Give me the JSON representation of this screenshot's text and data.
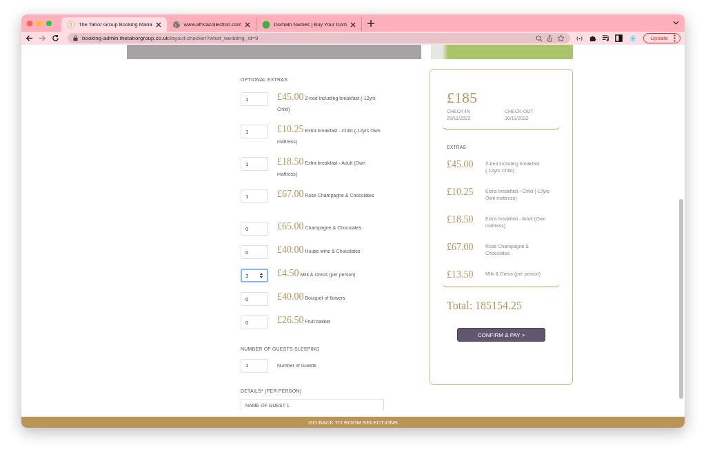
{
  "browser": {
    "tabs": [
      {
        "title": "The Tabor Group Booking Mana",
        "selected": true
      },
      {
        "title": "www.africacollection.com",
        "selected": false
      },
      {
        "title": "Domain Names | Buy Your Dom",
        "selected": false
      }
    ],
    "url_host": "booking-admin.thetaborgroup.co.uk",
    "url_path": "/layout-checker?what_wedding_id=9",
    "update_label": "Update"
  },
  "optional_extras": {
    "heading": "OPTIONAL EXTRAS",
    "items": [
      {
        "quantity": "1",
        "price": "£45.00",
        "name": "Z-bed including breakfast (-12yrs Child)",
        "focused": false
      },
      {
        "quantity": "1",
        "price": "£10.25",
        "name": "Extra breakfast - Child (-12yrs Own mattress)",
        "focused": false
      },
      {
        "quantity": "1",
        "price": "£18.50",
        "name": "Extra breakfast - Adult (Own mattress)",
        "focused": false
      },
      {
        "quantity": "1",
        "price": "£67.00",
        "name": "Rose Champagne & Chocolates",
        "focused": false
      },
      {
        "quantity": "0",
        "price": "£65.00",
        "name": "Champagne & Chocolates",
        "focused": false
      },
      {
        "quantity": "0",
        "price": "£40.00",
        "name": "House wine & Chocolates",
        "focused": false
      },
      {
        "quantity": "3",
        "price": "£4.50",
        "name": "Milk & Oreos (per person)",
        "focused": true
      },
      {
        "quantity": "0",
        "price": "£40.00",
        "name": "Bouquet of flowers",
        "focused": false
      },
      {
        "quantity": "0",
        "price": "£26.50",
        "name": "Fruit basket",
        "focused": false
      }
    ]
  },
  "guests": {
    "heading": "NUMBER OF GUESTS SLEEPING",
    "quantity": "1",
    "label": "Number of Guests"
  },
  "details": {
    "heading": "DETAILS* (PER PERSON)",
    "guest_placeholder": "NAME OF GUEST 1"
  },
  "summary": {
    "room_price": "£185",
    "check_in_label": "CHECK-IN",
    "check_in": "29/11/2022",
    "check_out_label": "CHECK-OUT",
    "check_out": "30/11/2022",
    "extras_heading": "EXTRAS",
    "extras": [
      {
        "price": "£45.00",
        "name": "Z-bed including breakfast (-12yrs Child)"
      },
      {
        "price": "£10.25",
        "name": "Extra breakfast - Child (-12yrs Own mattress)"
      },
      {
        "price": "£18.50",
        "name": "Extra breakfast - Adult (Own mattress)"
      },
      {
        "price": "£67.00",
        "name": "Rose Champagne & Chocolates"
      },
      {
        "price": "£13.50",
        "name": "Milk & Oreos (per person)"
      }
    ],
    "total": "Total: 185154.25",
    "confirm_label": "CONFIRM & PAY >"
  },
  "footer": {
    "back_label": "GO BACK TO ROOM SELECTIONS"
  }
}
